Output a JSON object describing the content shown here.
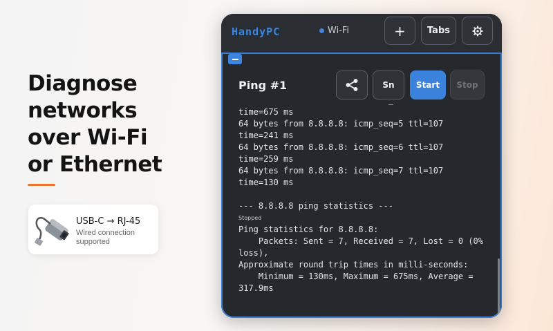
{
  "promo": {
    "headline_lines": [
      "Diagnose",
      "networks",
      "over Wi-Fi",
      "or Ethernet"
    ],
    "adapter_title": "USB-C → RJ-45",
    "adapter_subtitle": "Wired connection supported"
  },
  "app": {
    "brand": "HandyPC",
    "connection": "Wi-Fi",
    "toolbar": {
      "add_label": "+",
      "tabs_label": "Tabs",
      "settings_icon": "gear-icon"
    },
    "panel": {
      "title": "Ping #1",
      "share_icon": "share-icon",
      "sn_label": "Sn",
      "start_label": "Start",
      "stop_label": "Stop",
      "console_top_partial": "                              –",
      "console_lines": [
        "time=675 ms",
        "64 bytes from 8.8.8.8: icmp_seq=5 ttl=107",
        "time=241 ms",
        "64 bytes from 8.8.8.8: icmp_seq=6 ttl=107",
        "time=259 ms",
        "64 bytes from 8.8.8.8: icmp_seq=7 ttl=107",
        "time=130 ms",
        "",
        "--- 8.8.8.8 ping statistics ---"
      ],
      "status": "Stopped",
      "summary_lines": [
        "Ping statistics for 8.8.8.8:",
        "    Packets: Sent = 7, Received = 7, Lost = 0 (0%",
        "loss),",
        "Approximate round trip times in milli-seconds:",
        "    Minimum = 130ms, Maximum = 675ms, Average =",
        "317.9ms"
      ]
    }
  },
  "colors": {
    "accent": "#3d86e0",
    "orange": "#e8762e"
  }
}
